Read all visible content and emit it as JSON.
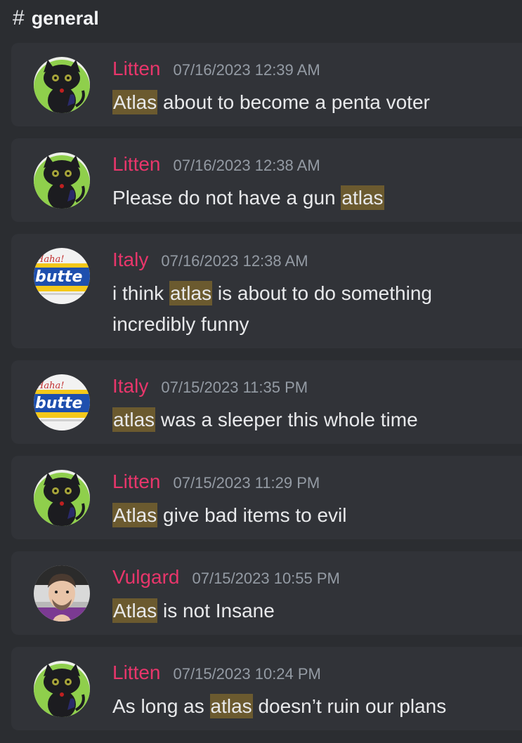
{
  "channel": {
    "hash_symbol": "#",
    "name": "general"
  },
  "messages": [
    {
      "author": "Litten",
      "avatar": "black-cat-avatar",
      "timestamp": "07/16/2023 12:39 AM",
      "text_before": "",
      "mention": "Atlas",
      "text_after": " about to become a penta voter"
    },
    {
      "author": "Litten",
      "avatar": "black-cat-avatar",
      "timestamp": "07/16/2023 12:38 AM",
      "text_before": "Please do not have a gun ",
      "mention": "atlas",
      "text_after": ""
    },
    {
      "author": "Italy",
      "avatar": "butter-sticker-avatar",
      "timestamp": "07/16/2023 12:38 AM",
      "text_before": "i think ",
      "mention": "atlas",
      "text_after": " is about to do something incredibly funny"
    },
    {
      "author": "Italy",
      "avatar": "butter-sticker-avatar",
      "timestamp": "07/15/2023 11:35 PM",
      "text_before": "",
      "mention": "atlas",
      "text_after": " was a sleeper this whole time"
    },
    {
      "author": "Litten",
      "avatar": "black-cat-avatar",
      "timestamp": "07/15/2023 11:29 PM",
      "text_before": "",
      "mention": "Atlas",
      "text_after": " give bad items to evil"
    },
    {
      "author": "Vulgard",
      "avatar": "cartoon-man-avatar",
      "timestamp": "07/15/2023 10:55 PM",
      "text_before": "",
      "mention": "Atlas",
      "text_after": " is not Insane"
    },
    {
      "author": "Litten",
      "avatar": "black-cat-avatar",
      "timestamp": "07/15/2023 10:24 PM",
      "text_before": "As long as ",
      "mention": "atlas",
      "text_after": " doesn’t ruin our plans"
    }
  ],
  "colors": {
    "background": "#2b2d31",
    "card": "#313338",
    "author": "#e8366b",
    "timestamp": "#949ba4",
    "mention_highlight": "#6b5a2f"
  }
}
